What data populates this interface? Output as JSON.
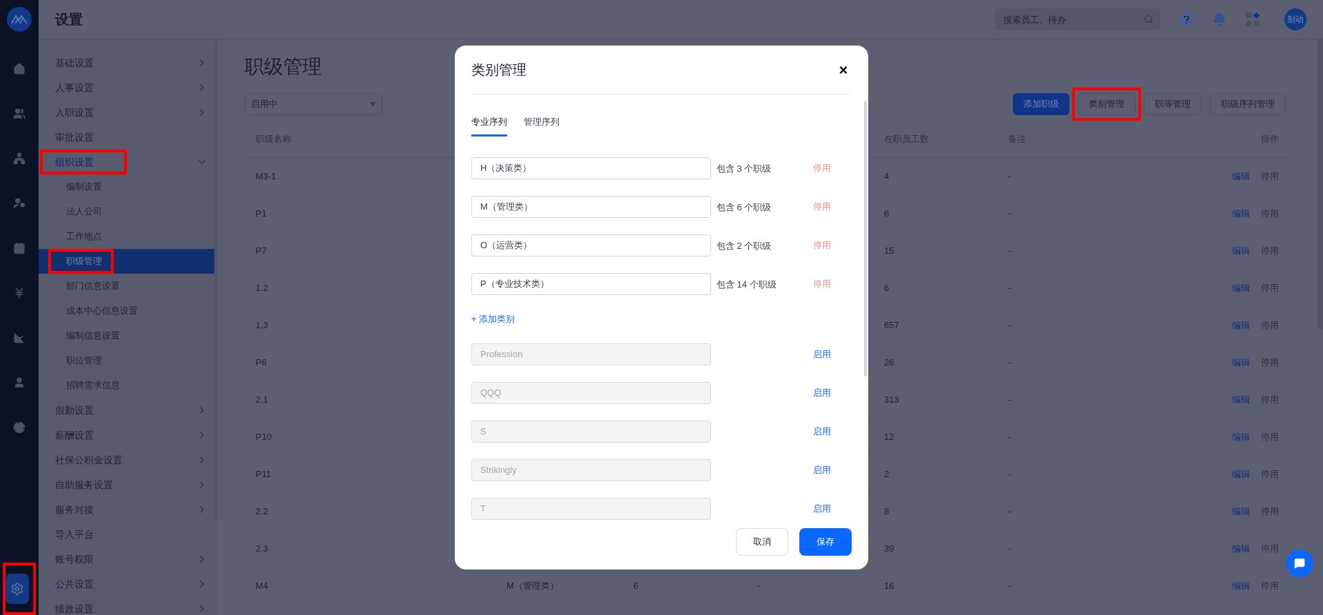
{
  "app": {
    "title": "设置"
  },
  "header": {
    "search": {
      "placeholder": "搜索员工、待办"
    },
    "avatar": "别动"
  },
  "nav_rail": [
    {
      "selected": false,
      "highlighted": false
    },
    {
      "selected": false,
      "highlighted": false
    },
    {
      "selected": false,
      "highlighted": false
    },
    {
      "selected": false,
      "highlighted": false
    },
    {
      "selected": false,
      "highlighted": false
    },
    {
      "selected": false,
      "highlighted": false
    },
    {
      "selected": false,
      "highlighted": false
    },
    {
      "selected": false,
      "highlighted": false
    },
    {
      "selected": false,
      "highlighted": false
    },
    {
      "selected": true,
      "highlighted": true
    }
  ],
  "sidebar": {
    "items": [
      {
        "label": "基础设置",
        "expandable": true,
        "expanded": false,
        "highlighted": false
      },
      {
        "label": "人事设置",
        "expandable": true,
        "expanded": false,
        "highlighted": false
      },
      {
        "label": "入职设置",
        "expandable": true,
        "expanded": false,
        "highlighted": false
      },
      {
        "label": "审批设置",
        "expandable": false,
        "highlighted": false
      },
      {
        "label": "组织设置",
        "expandable": true,
        "expanded": true,
        "highlighted": true,
        "children": [
          {
            "label": "编制设置",
            "selected": false,
            "highlighted": false
          },
          {
            "label": "法人公司",
            "selected": false,
            "highlighted": false
          },
          {
            "label": "工作地点",
            "selected": false,
            "highlighted": false
          },
          {
            "label": "职级管理",
            "selected": true,
            "highlighted": true
          },
          {
            "label": "部门信息设置",
            "selected": false,
            "highlighted": false
          },
          {
            "label": "成本中心信息设置",
            "selected": false,
            "highlighted": false
          },
          {
            "label": "编制信息设置",
            "selected": false,
            "highlighted": false
          },
          {
            "label": "职位管理",
            "selected": false,
            "highlighted": false
          },
          {
            "label": "招聘需求信息",
            "selected": false,
            "highlighted": false
          }
        ]
      },
      {
        "label": "假勤设置",
        "expandable": true,
        "expanded": false,
        "highlighted": false
      },
      {
        "label": "薪酬设置",
        "expandable": true,
        "expanded": false,
        "highlighted": false
      },
      {
        "label": "社保公积金设置",
        "expandable": true,
        "expanded": false,
        "highlighted": false
      },
      {
        "label": "自助服务设置",
        "expandable": true,
        "expanded": false,
        "highlighted": false
      },
      {
        "label": "服务对接",
        "expandable": true,
        "expanded": false,
        "highlighted": false
      },
      {
        "label": "导入平台",
        "expandable": false,
        "highlighted": false
      },
      {
        "label": "账号权限",
        "expandable": true,
        "expanded": false,
        "highlighted": false
      },
      {
        "label": "公共设置",
        "expandable": true,
        "expanded": false,
        "highlighted": false
      },
      {
        "label": "绩效设置",
        "expandable": true,
        "expanded": false,
        "highlighted": false
      }
    ]
  },
  "page": {
    "title": "职级管理",
    "filter": {
      "value": "启用中"
    },
    "buttons": [
      {
        "label": "添加职级",
        "kind": "primary",
        "highlighted": false
      },
      {
        "label": "类别管理",
        "kind": "outline",
        "highlighted": true
      },
      {
        "label": "职等管理",
        "kind": "outline",
        "highlighted": false
      },
      {
        "label": "职级序列管理",
        "kind": "outline",
        "highlighted": false
      }
    ],
    "table": {
      "columns": {
        "name": "职级名称",
        "count": "在职员工数",
        "note": "备注",
        "actions": "操作"
      },
      "rows": [
        {
          "name": "M3-1",
          "count": "4",
          "note": "-",
          "edit": "编辑",
          "disable": "停用"
        },
        {
          "name": "P1",
          "count": "6",
          "note": "-",
          "edit": "编辑",
          "disable": "停用"
        },
        {
          "name": "P7",
          "count": "15",
          "note": "-",
          "edit": "编辑",
          "disable": "停用"
        },
        {
          "name": "1.2",
          "count": "6",
          "note": "-",
          "edit": "编辑",
          "disable": "停用"
        },
        {
          "name": "1.3",
          "count": "657",
          "note": "-",
          "edit": "编辑",
          "disable": "停用"
        },
        {
          "name": "P6",
          "count": "26",
          "note": "-",
          "edit": "编辑",
          "disable": "停用"
        },
        {
          "name": "2.1",
          "count": "313",
          "note": "-",
          "edit": "编辑",
          "disable": "停用"
        },
        {
          "name": "P10",
          "count": "12",
          "note": "-",
          "edit": "编辑",
          "disable": "停用"
        },
        {
          "name": "P11",
          "count": "2",
          "note": "-",
          "edit": "编辑",
          "disable": "停用"
        },
        {
          "name": "2.2",
          "count": "8",
          "note": "-",
          "edit": "编辑",
          "disable": "停用"
        },
        {
          "name": "2.3",
          "count": "39",
          "note": "-",
          "edit": "编辑",
          "disable": "停用"
        },
        {
          "name": "M4",
          "column_2": "M（管理类）",
          "column_3": "6",
          "column_4": "-",
          "count": "16",
          "note": "-",
          "edit": "编辑",
          "disable": "停用"
        }
      ]
    }
  },
  "modal": {
    "title": "类别管理",
    "close": "×",
    "tabs": [
      {
        "label": "专业序列",
        "selected": true
      },
      {
        "label": "管理序列",
        "selected": false
      }
    ],
    "categories": [
      {
        "value": "H（决策类）",
        "enabled": true,
        "count_text": "包含 3 个职级",
        "action": "停用"
      },
      {
        "value": "M（管理类）",
        "enabled": true,
        "count_text": "包含 6 个职级",
        "action": "停用"
      },
      {
        "value": "O（运营类）",
        "enabled": true,
        "count_text": "包含 2 个职级",
        "action": "停用"
      },
      {
        "value": "P（专业技术类）",
        "enabled": true,
        "count_text": "包含 14 个职级",
        "action": "停用"
      },
      {
        "value": "Profession",
        "enabled": false,
        "action": "启用"
      },
      {
        "value": "QQQ",
        "enabled": false,
        "action": "启用"
      },
      {
        "value": "S",
        "enabled": false,
        "action": "启用"
      },
      {
        "value": "Strikingly",
        "enabled": false,
        "action": "启用"
      },
      {
        "value": "T",
        "enabled": false,
        "action": "启用"
      }
    ],
    "add_link": "+ 添加类别",
    "cancel": "取消",
    "save": "保存"
  }
}
